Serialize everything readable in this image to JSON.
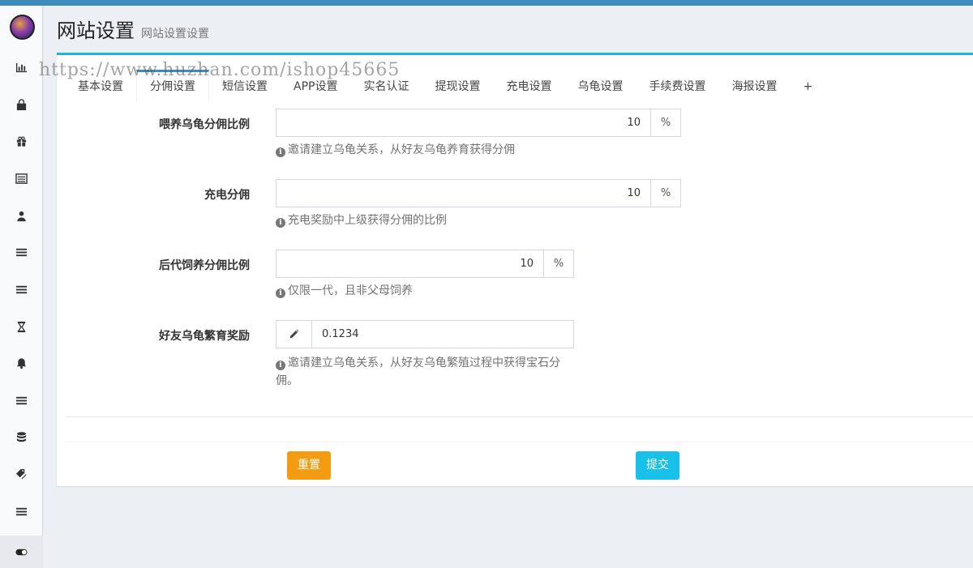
{
  "header": {
    "title": "网站设置",
    "subtitle": "网站设置设置"
  },
  "watermark": "https://www.huzhan.com/ishop45665",
  "tabs": [
    {
      "label": "基本设置",
      "active": false
    },
    {
      "label": "分佣设置",
      "active": true
    },
    {
      "label": "短信设置",
      "active": false
    },
    {
      "label": "APP设置",
      "active": false
    },
    {
      "label": "实名认证",
      "active": false
    },
    {
      "label": "提现设置",
      "active": false
    },
    {
      "label": "充电设置",
      "active": false
    },
    {
      "label": "乌龟设置",
      "active": false
    },
    {
      "label": "手续费设置",
      "active": false
    },
    {
      "label": "海报设置",
      "active": false
    },
    {
      "label": "+",
      "active": false
    }
  ],
  "sidebar": {
    "icons": [
      "chart-icon",
      "shopping-bag-icon",
      "gift-icon",
      "list-alt-icon",
      "user-icon",
      "bars-icon",
      "bars-icon",
      "hourglass-icon",
      "bell-icon",
      "bars-icon",
      "database-icon",
      "tags-icon",
      "bars-icon",
      "toggle-icon"
    ]
  },
  "form": {
    "feed_turtle": {
      "label": "喂养乌龟分佣比例",
      "value": "10",
      "unit": "%",
      "help": "邀请建立乌龟关系，从好友乌龟养育获得分佣"
    },
    "charge": {
      "label": "充电分佣",
      "value": "10",
      "unit": "%",
      "help": "充电奖励中上级获得分佣的比例"
    },
    "offspring": {
      "label": "后代饲养分佣比例",
      "value": "10",
      "unit": "%",
      "help": "仅限一代，且非父母饲养"
    },
    "breeding": {
      "label": "好友乌龟繁育奖励",
      "value": "0.1234",
      "help": "邀请建立乌龟关系，从好友乌龟繁殖过程中获得宝石分佣。"
    }
  },
  "buttons": {
    "reset": "重置",
    "submit": "提交"
  }
}
